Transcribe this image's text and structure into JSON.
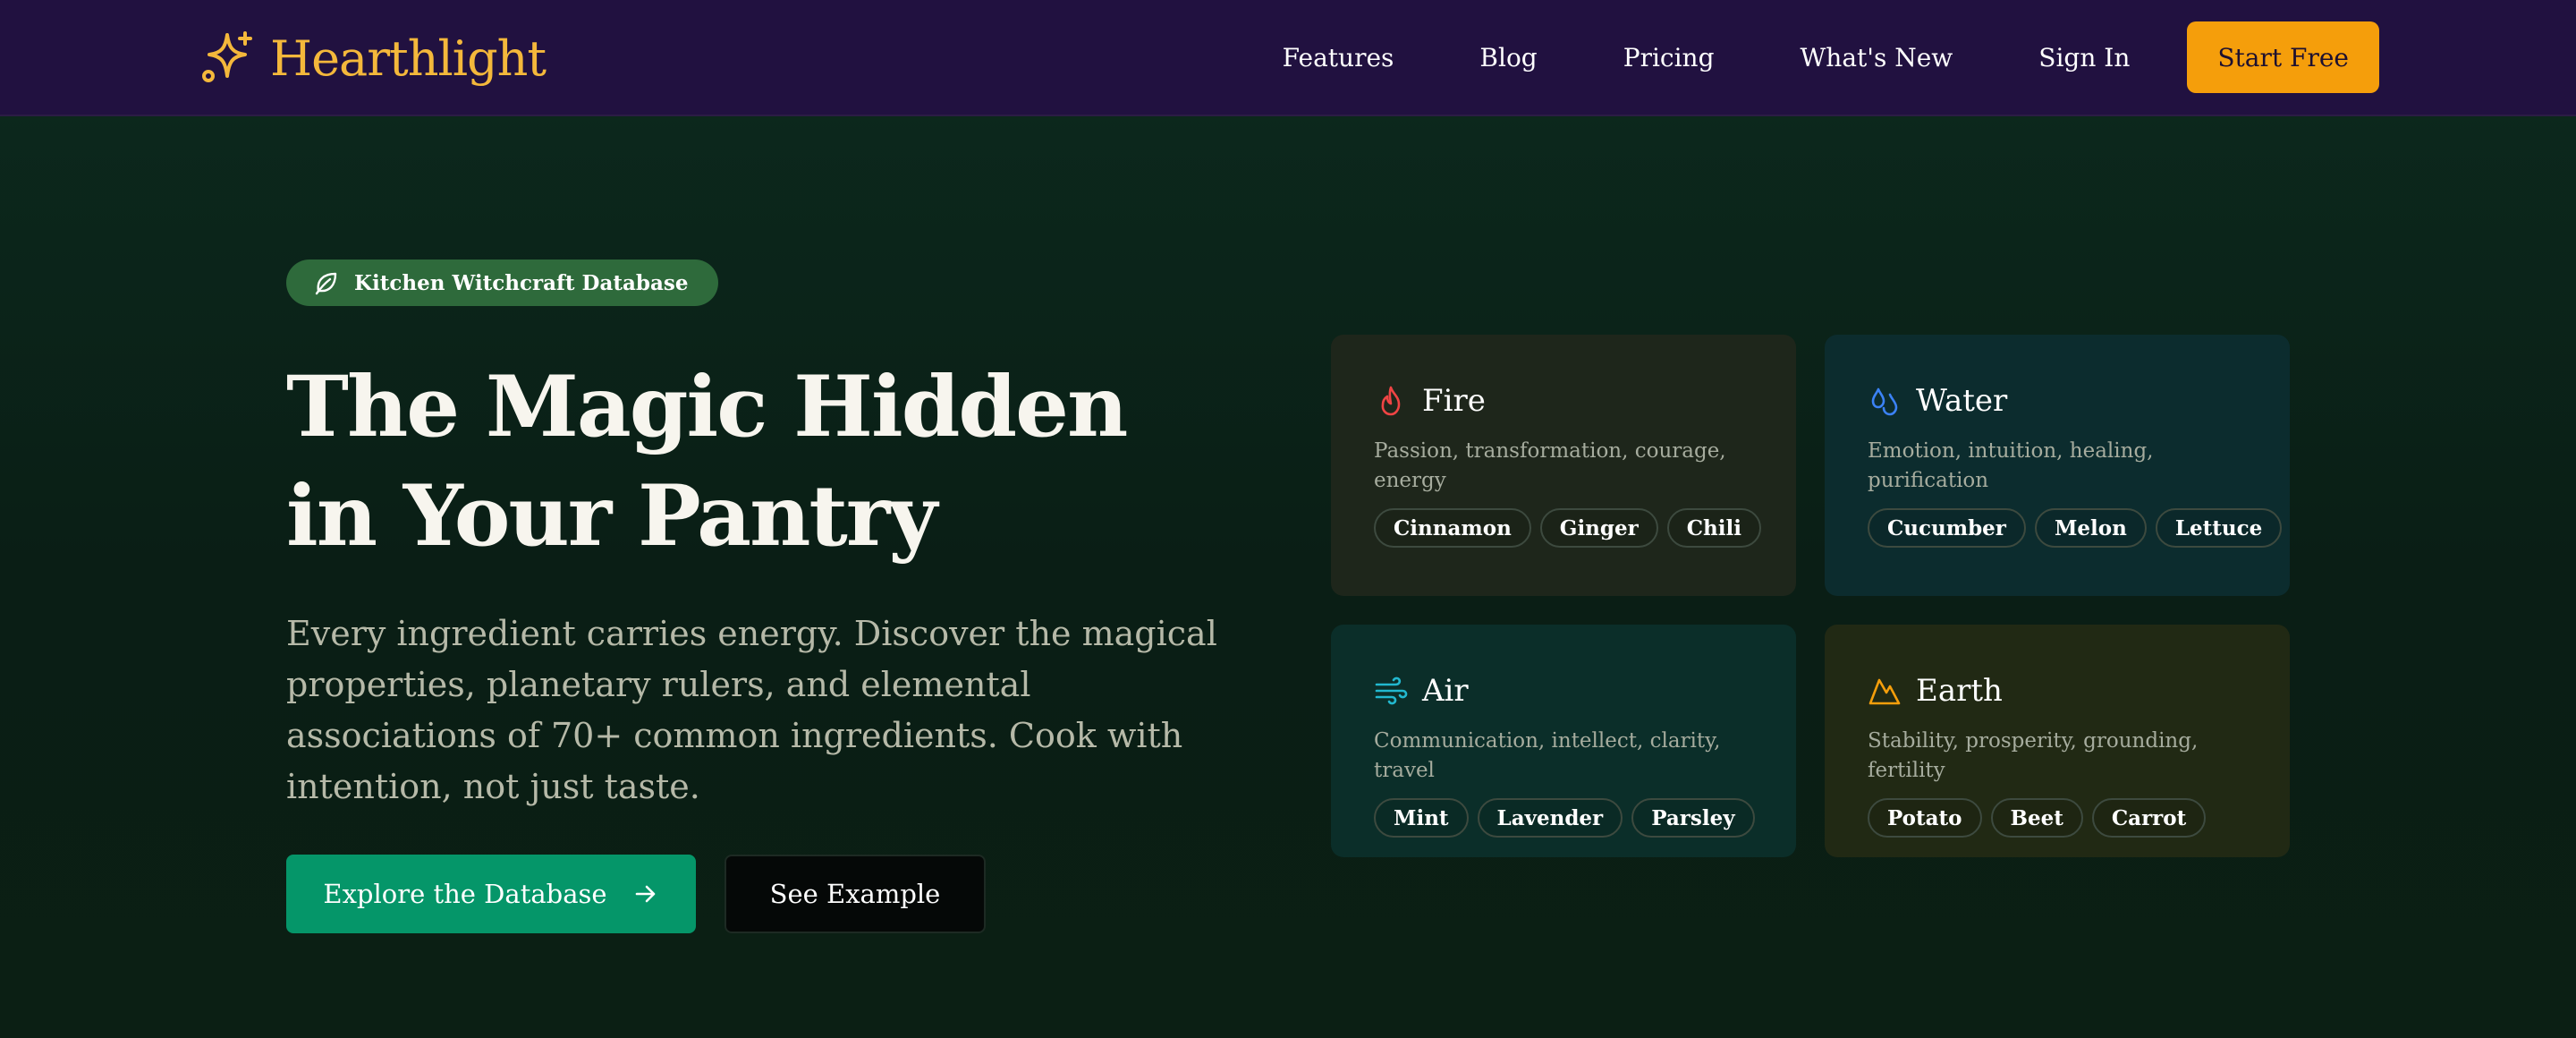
{
  "nav": {
    "brand": "Hearthlight",
    "links": [
      "Features",
      "Blog",
      "Pricing",
      "What's New",
      "Sign In"
    ],
    "cta": "Start Free"
  },
  "hero": {
    "badge": "Kitchen Witchcraft Database",
    "title": "The Magic Hidden in Your Pantry",
    "subtitle": "Every ingredient carries energy. Discover the magical properties, planetary rulers, and elemental associations of 70+ common ingredients. Cook with intention, not just taste.",
    "primary_button": "Explore the Database",
    "secondary_button": "See Example"
  },
  "elements": [
    {
      "name": "Fire",
      "icon": "flame-icon",
      "color": "#ef4444",
      "description": "Passion, transformation, courage, energy",
      "tags": [
        "Cinnamon",
        "Ginger",
        "Chili"
      ]
    },
    {
      "name": "Water",
      "icon": "droplets-icon",
      "color": "#3b82f6",
      "description": "Emotion, intuition, healing, purification",
      "tags": [
        "Cucumber",
        "Melon",
        "Lettuce"
      ]
    },
    {
      "name": "Air",
      "icon": "wind-icon",
      "color": "#22b8cf",
      "description": "Communication, intellect, clarity, travel",
      "tags": [
        "Mint",
        "Lavender",
        "Parsley"
      ]
    },
    {
      "name": "Earth",
      "icon": "mountain-icon",
      "color": "#f59e0b",
      "description": "Stability, prosperity, grounding, fertility",
      "tags": [
        "Potato",
        "Beet",
        "Carrot"
      ]
    }
  ],
  "colors": {
    "nav_bg": "#211140",
    "brand": "#f4b83b",
    "cta": "#f59e0b",
    "primary": "#059669",
    "badge_bg": "#2e6a3b"
  }
}
